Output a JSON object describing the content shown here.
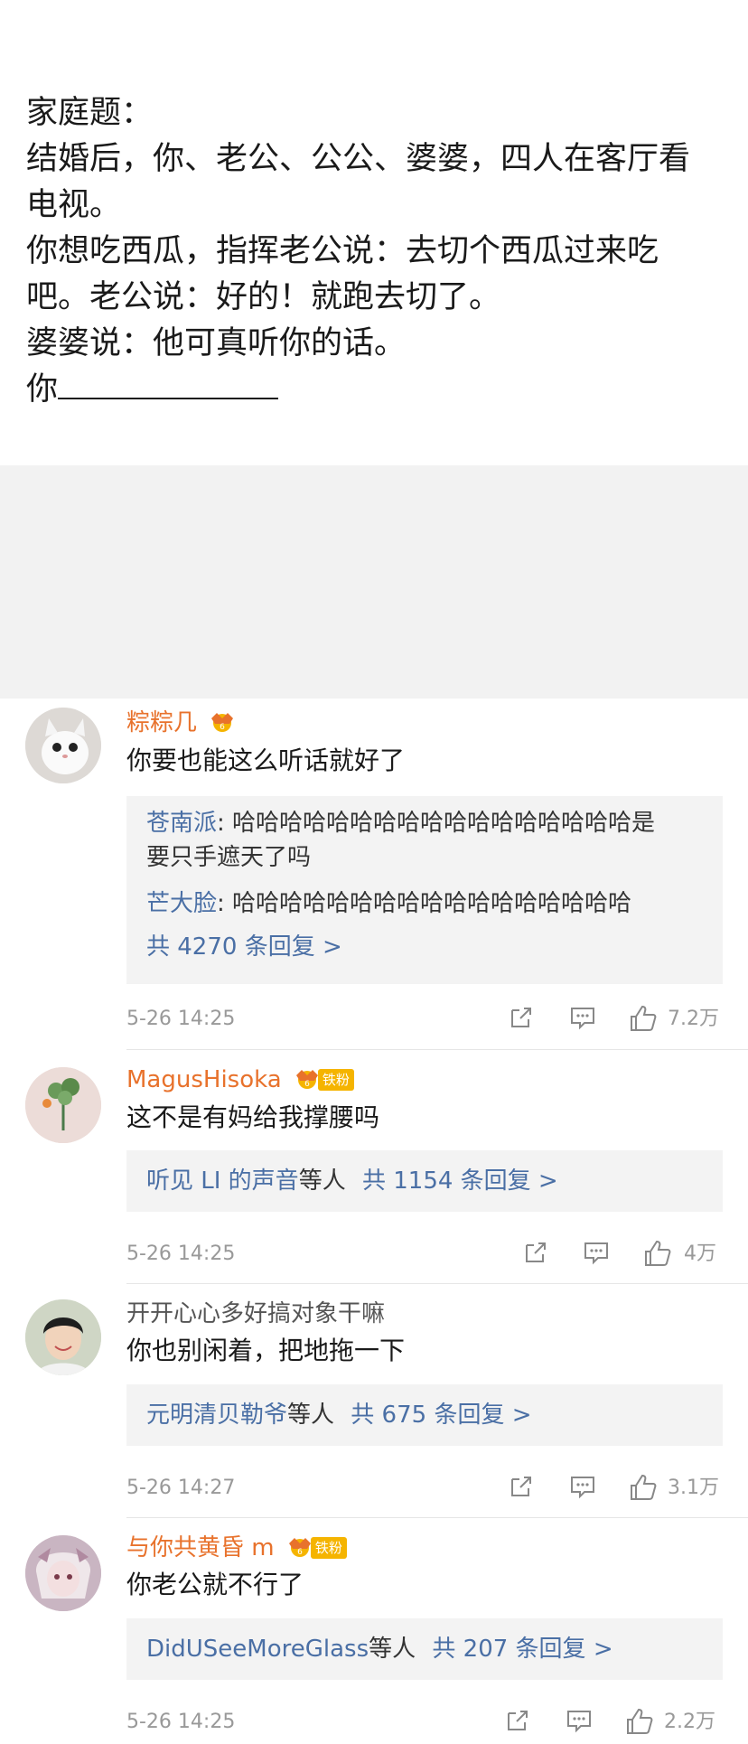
{
  "post": {
    "lines": [
      "家庭题：",
      "结婚后，你、老公、公公、婆婆，四人在客厅看",
      "电视。",
      "你想吃西瓜，指挥老公说：去切个西瓜过来吃",
      "吧。老公说：好的！就跑去切了。",
      "婆婆说：他可真听你的话。",
      "你"
    ]
  },
  "comments": [
    {
      "name": "粽粽几",
      "text": "你要也能这么听话就好了",
      "replies": [
        {
          "user": "苍南派",
          "text_1": "哈哈哈哈哈哈哈哈哈哈哈哈哈哈哈哈哈是",
          "text_2": "要只手遮天了吗"
        },
        {
          "user": "芒大脸",
          "text_1": "哈哈哈哈哈哈哈哈哈哈哈哈哈哈哈哈哈"
        }
      ],
      "more": "共 4270 条回复 >",
      "time": "5-26 14:25",
      "likes": "7.2万"
    },
    {
      "name": "MagusHisoka",
      "badge": "铁粉",
      "text": "这不是有妈给我撑腰吗",
      "reply_user": "听见 LI 的声音",
      "reply_suffix": "等人",
      "more": "共 1154 条回复 >",
      "time": "5-26 14:25",
      "likes": "4万"
    },
    {
      "name": "开开心心多好搞对象干嘛",
      "text": "你也别闲着，把地拖一下",
      "reply_user": "元明清贝勒爷",
      "reply_suffix": "等人",
      "more": "共 675 条回复 >",
      "time": "5-26 14:27",
      "likes": "3.1万"
    },
    {
      "name": "与你共黄昏 m",
      "badge": "铁粉",
      "text": "你老公就不行了",
      "reply_user": "DidUSeeMoreGlass",
      "reply_suffix": "等人",
      "more": "共 207 条回复 >",
      "time": "5-26 14:25",
      "likes": "2.2万"
    }
  ],
  "icons": {
    "share": "share-icon",
    "comment": "comment-icon",
    "like": "thumbs-up-icon",
    "vip": "vip-crown-icon"
  },
  "colors": {
    "name_orange": "#e8722c",
    "link_blue": "#4a6fa5",
    "meta_gray": "#999999",
    "badge_yellow": "#f5b400"
  }
}
